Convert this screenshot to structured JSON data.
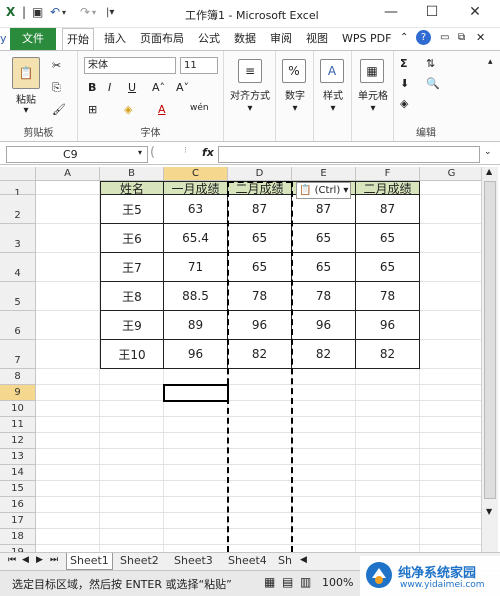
{
  "window": {
    "title": "工作簿1 - Microsoft Excel",
    "minimize": "—",
    "maximize": "☐",
    "close": "✕"
  },
  "ribbon_tabs": [
    "文件",
    "开始",
    "插入",
    "页面布局",
    "公式",
    "数据",
    "审阅",
    "视图",
    "WPS PDF"
  ],
  "ribbon": {
    "clipboard": {
      "label": "剪贴板",
      "paste": "粘贴"
    },
    "font": {
      "label": "字体",
      "name": "宋体",
      "size": "11",
      "bold": "B",
      "italic": "I",
      "underline": "U",
      "font_color_btn": "A",
      "wen_btn": "wén"
    },
    "alignment": {
      "label": "对齐方式"
    },
    "number": {
      "label": "数字",
      "icon": "%"
    },
    "styles": {
      "label": "样式"
    },
    "cells": {
      "label": "单元格"
    },
    "editing": {
      "label": "编辑",
      "sum": "Σ"
    }
  },
  "formula_bar": {
    "name_box": "C9",
    "fx": "fx",
    "content": ""
  },
  "columns": [
    "A",
    "B",
    "C",
    "D",
    "E",
    "F",
    "G"
  ],
  "rows": [
    "1",
    "2",
    "3",
    "4",
    "5",
    "6",
    "7",
    "8",
    "9",
    "10",
    "11",
    "12",
    "13",
    "14",
    "15",
    "16",
    "17",
    "18",
    "19"
  ],
  "table": {
    "headers": [
      "姓名",
      "一月成绩",
      "二月成绩",
      "",
      "二月成绩"
    ],
    "rows": [
      [
        "王5",
        "63",
        "87",
        "87",
        "87"
      ],
      [
        "王6",
        "65.4",
        "65",
        "65",
        "65"
      ],
      [
        "王7",
        "71",
        "65",
        "65",
        "65"
      ],
      [
        "王8",
        "88.5",
        "78",
        "78",
        "78"
      ],
      [
        "王9",
        "89",
        "96",
        "96",
        "96"
      ],
      [
        "王10",
        "96",
        "82",
        "82",
        "82"
      ]
    ]
  },
  "paste_options": {
    "label": "(Ctrl)"
  },
  "sheets": [
    "Sheet1",
    "Sheet2",
    "Sheet3",
    "Sheet4",
    "Sh"
  ],
  "status": {
    "message": "选定目标区域，然后按 ENTER 或选择“粘贴”",
    "zoom": "100%"
  }
}
